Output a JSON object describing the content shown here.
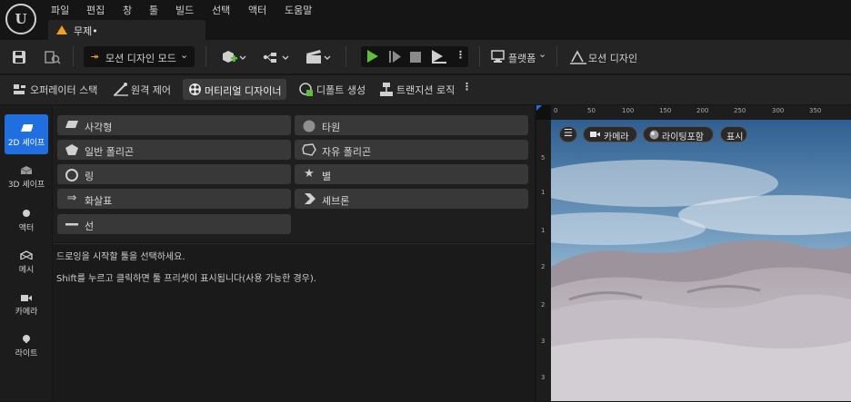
{
  "app": {
    "logo_icon": "unreal-logo-icon",
    "menu": [
      "파일",
      "편집",
      "창",
      "툴",
      "빌드",
      "선택",
      "액터",
      "도움말"
    ],
    "document_tab": "무제•"
  },
  "toolbar": {
    "mode_label": "모션 디자인 모드",
    "platform_label": "플랫폼",
    "motion_design_label": "모션 디자인"
  },
  "toolbar2": {
    "items": [
      "오퍼레이터 스택",
      "원격 제어",
      "머티리얼 디자이너",
      "디폴트 생성",
      "트랜지션 로직"
    ]
  },
  "rail": {
    "items": [
      "2D 셰이프",
      "3D 셰이프",
      "액터",
      "메시",
      "카메라",
      "라이트"
    ],
    "active": "2D 셰이프"
  },
  "shapes": {
    "left": [
      "사각형",
      "일반 폴리곤",
      "링",
      "화살표",
      "선"
    ],
    "right": [
      "타원",
      "자유 폴리곤",
      "별",
      "셰브론"
    ]
  },
  "messages": {
    "line1": "드로잉을 시작할 툴을 선택하세요.",
    "line2": "Shift를 누르고 클릭하면 툴 프리셋이 표시됩니다(사용 가능한 경우)."
  },
  "viewport": {
    "menu_icon": "hamburger-icon",
    "camera_label": "카메라",
    "lighting_label": "라이팅포함",
    "show_label": "표시",
    "ruler_top": [
      "0",
      "50",
      "100",
      "150",
      "200",
      "250",
      "300",
      "350"
    ],
    "ruler_left": [
      "5",
      "1",
      "1",
      "2",
      "2",
      "3",
      "3"
    ]
  },
  "colors": {
    "accent_blue": "#1f6fe0",
    "play_green": "#5fbe3f",
    "warning_orange": "#f0a020"
  }
}
